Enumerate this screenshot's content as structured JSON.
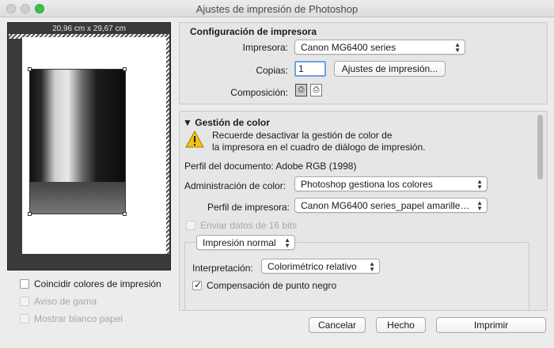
{
  "window": {
    "title": "Ajustes de impresión de Photoshop"
  },
  "preview": {
    "dimensions": "20,96 cm x 29,67 cm"
  },
  "left_options": [
    {
      "label": "Coincidir colores de impresión",
      "checked": false,
      "enabled": true
    },
    {
      "label": "Aviso de gama",
      "checked": false,
      "enabled": false
    },
    {
      "label": "Mostrar blanco papel",
      "checked": false,
      "enabled": false
    }
  ],
  "printer_setup": {
    "title": "Configuración de impresora",
    "printer_label": "Impresora:",
    "printer_value": "Canon MG6400 series",
    "copies_label": "Copias:",
    "copies_value": "1",
    "print_settings_button": "Ajustes de impresión...",
    "layout_label": "Composición:"
  },
  "color_management": {
    "title": "Gestión de color",
    "warning_line1": "Recuerde desactivar la gestión de color de",
    "warning_line2": "la impresora en el cuadro de diálogo de impresión.",
    "document_profile": "Perfil del documento: Adobe RGB (1998)",
    "color_handling_label": "Administración de color:",
    "color_handling_value": "Photoshop gestiona los colores",
    "printer_profile_label": "Perfil de impresora:",
    "printer_profile_value": "Canon MG6400 series_papel amarillent…",
    "send_16bit_label": "Enviar datos de 16 bits",
    "print_mode_value": "Impresión normal",
    "rendering_label": "Interpretación:",
    "rendering_value": "Colorimétrico relativo",
    "black_point_label": "Compensación de punto negro"
  },
  "footer": {
    "cancel": "Cancelar",
    "done": "Hecho",
    "print": "Imprimir"
  },
  "colors": {
    "focus_ring": "#6ea0e8",
    "title_text": "#4a4a4a"
  }
}
